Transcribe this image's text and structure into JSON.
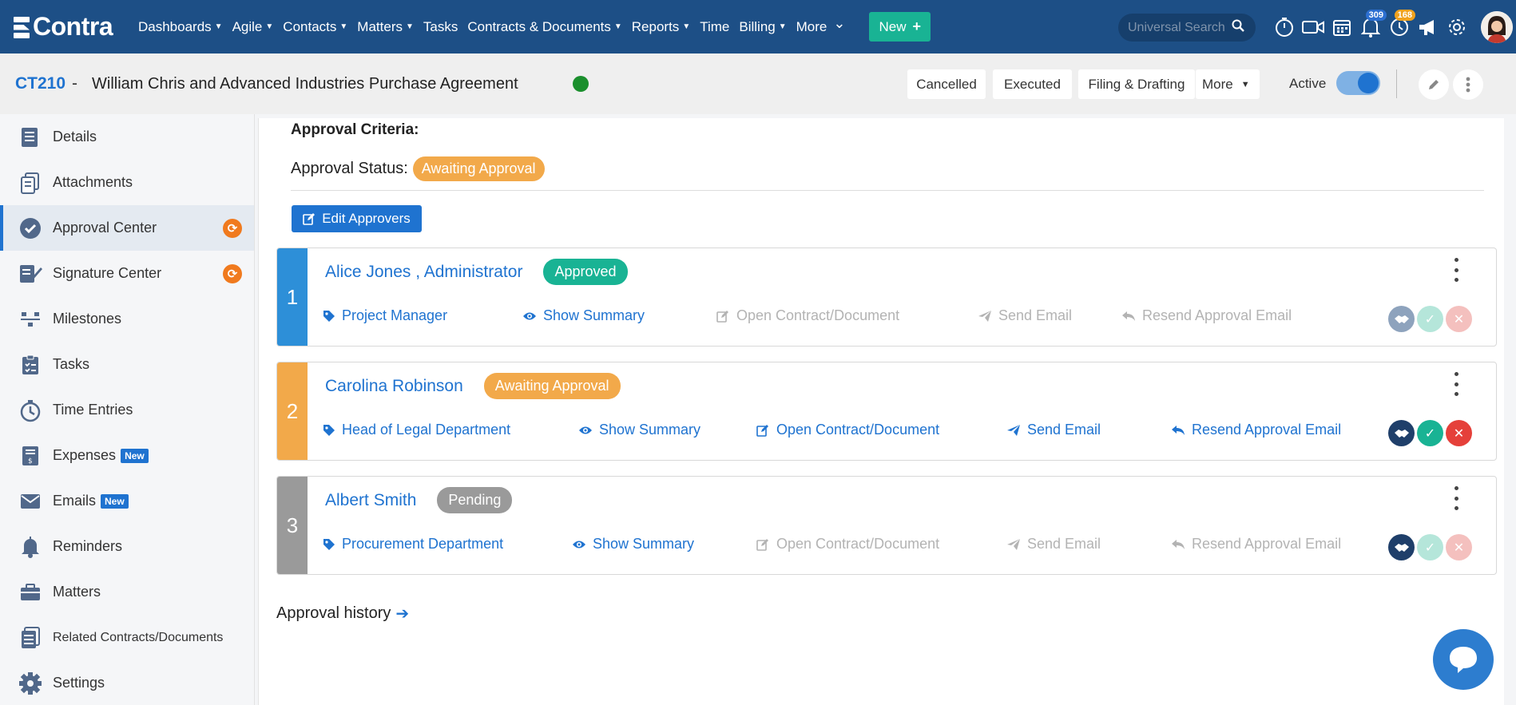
{
  "nav": {
    "logo": "Contra",
    "items": [
      {
        "label": "Dashboards",
        "caret": true
      },
      {
        "label": "Agile",
        "caret": true
      },
      {
        "label": "Contacts",
        "caret": true
      },
      {
        "label": "Matters",
        "caret": true
      },
      {
        "label": "Tasks",
        "caret": false
      },
      {
        "label": "Contracts & Documents",
        "caret": true
      },
      {
        "label": "Reports",
        "caret": true
      },
      {
        "label": "Time",
        "caret": false
      },
      {
        "label": "Billing",
        "caret": true
      },
      {
        "label": "More",
        "caret": true
      }
    ],
    "new_button": "New",
    "search_placeholder": "Universal Search",
    "notifications_count": "309",
    "reminders_count": "168"
  },
  "header": {
    "code": "CT210",
    "separator": "-",
    "title": "William Chris and Advanced Industries Purchase Agreement",
    "buttons": {
      "cancelled": "Cancelled",
      "executed": "Executed",
      "filing": "Filing & Drafting",
      "more": "More"
    },
    "active_label": "Active",
    "active_toggle": true
  },
  "sidebar": {
    "items": [
      {
        "label": "Details",
        "icon": "details-icon"
      },
      {
        "label": "Attachments",
        "icon": "attachments-icon"
      },
      {
        "label": "Approval Center",
        "icon": "approval-icon",
        "active": true,
        "sync": true
      },
      {
        "label": "Signature Center",
        "icon": "signature-icon",
        "sync": true
      },
      {
        "label": "Milestones",
        "icon": "milestones-icon"
      },
      {
        "label": "Tasks",
        "icon": "tasks-icon"
      },
      {
        "label": "Time Entries",
        "icon": "stopwatch-icon"
      },
      {
        "label": "Expenses",
        "icon": "expenses-icon",
        "badge": "New"
      },
      {
        "label": "Emails",
        "icon": "email-icon",
        "badge": "New"
      },
      {
        "label": "Reminders",
        "icon": "bell-icon"
      },
      {
        "label": "Matters",
        "icon": "briefcase-icon"
      },
      {
        "label": "Related Contracts/Documents",
        "icon": "related-icon"
      },
      {
        "label": "Settings",
        "icon": "gear-icon"
      }
    ]
  },
  "main": {
    "criteria_label": "Approval Criteria:",
    "status_label": "Approval Status:",
    "status_value": "Awaiting Approval",
    "edit_button": "Edit Approvers",
    "history_label": "Approval history",
    "approvers": [
      {
        "number": "1",
        "name": "Alice Jones , Administrator",
        "status": "Approved",
        "status_kind": "approved",
        "color": "#2d8fd8",
        "role": "Project Manager",
        "show_summary": "Show Summary",
        "open_doc": "Open Contract/Document",
        "send_email": "Send Email",
        "resend": "Resend Approval Email",
        "actions_enabled": false
      },
      {
        "number": "2",
        "name": "Carolina Robinson",
        "status": "Awaiting Approval",
        "status_kind": "awaiting",
        "color": "#f2a94a",
        "role": "Head of Legal Department",
        "show_summary": "Show Summary",
        "open_doc": "Open Contract/Document",
        "send_email": "Send Email",
        "resend": "Resend Approval Email",
        "actions_enabled": true
      },
      {
        "number": "3",
        "name": "Albert Smith",
        "status": "Pending",
        "status_kind": "pending",
        "color": "#9a9a9a",
        "role": "Procurement Department",
        "show_summary": "Show Summary",
        "open_doc": "Open Contract/Document",
        "send_email": "Send Email",
        "resend": "Resend Approval Email",
        "actions_enabled": false
      }
    ]
  }
}
